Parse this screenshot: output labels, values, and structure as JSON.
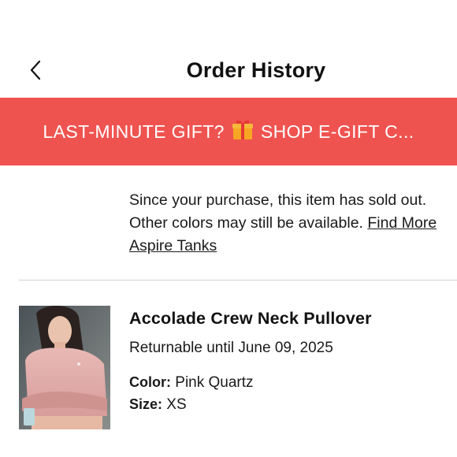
{
  "header": {
    "title": "Order History",
    "back_icon": "chevron-left-icon"
  },
  "promo": {
    "text_before": "LAST-MINUTE GIFT?",
    "icon": "gift-icon",
    "text_after": "SHOP E-GIFT C...",
    "background": "#ef5350"
  },
  "notice": {
    "line1": "Since your purchase, this item has sold out.",
    "line2_prefix": "Other colors may still be available.",
    "link_part1": "Find More",
    "link_part2": "Aspire Tanks"
  },
  "product": {
    "name": "Accolade Crew Neck Pullover",
    "returnable": "Returnable until June 09, 2025",
    "color_label": "Color:",
    "color_value": "Pink Quartz",
    "size_label": "Size:",
    "size_value": "XS"
  }
}
